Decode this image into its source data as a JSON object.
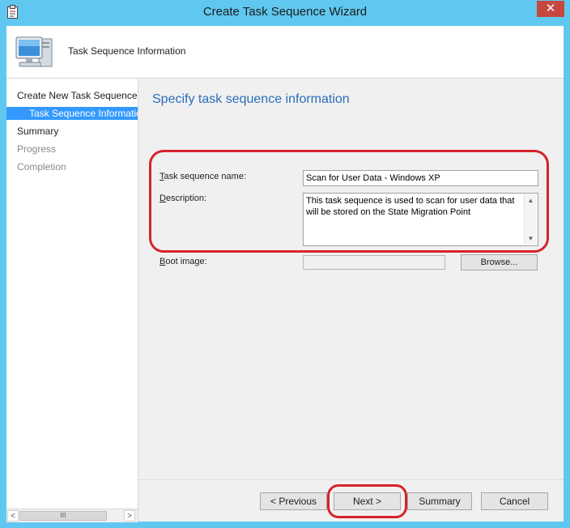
{
  "window": {
    "title": "Create Task Sequence Wizard",
    "close_label": "✕"
  },
  "header": {
    "title": "Task Sequence Information"
  },
  "nav": {
    "items": [
      {
        "label": "Create New Task Sequence",
        "state": "normal"
      },
      {
        "label": "Task Sequence Information",
        "state": "selected"
      },
      {
        "label": "Summary",
        "state": "normal"
      },
      {
        "label": "Progress",
        "state": "disabled"
      },
      {
        "label": "Completion",
        "state": "disabled"
      }
    ],
    "scroll_left": "<",
    "scroll_right": ">",
    "scroll_thumb": "III"
  },
  "main": {
    "page_title": "Specify task sequence information",
    "fields": {
      "name_label_access": "T",
      "name_label_rest": "ask sequence name:",
      "name_value": "Scan for User Data - Windows XP",
      "description_label_access": "D",
      "description_label_rest": "escription:",
      "description_value": "This task sequence is used to scan for user data that will be stored on the State Migration Point",
      "boot_label_access": "B",
      "boot_label_rest": "oot image:",
      "boot_value": ""
    },
    "browse_label": "Browse..."
  },
  "footer": {
    "previous_label": "< Previous",
    "next_label": "Next >",
    "summary_label": "Summary",
    "cancel_label": "Cancel"
  },
  "colors": {
    "title_bar": "#60c8f0",
    "accent_selected": "#3399ff",
    "page_title": "#2a6ebb",
    "annotation": "#d6232b",
    "close_button": "#c7473f"
  },
  "icons": {
    "app": "wizard-clipboard-icon",
    "header": "computer-monitor-icon"
  }
}
